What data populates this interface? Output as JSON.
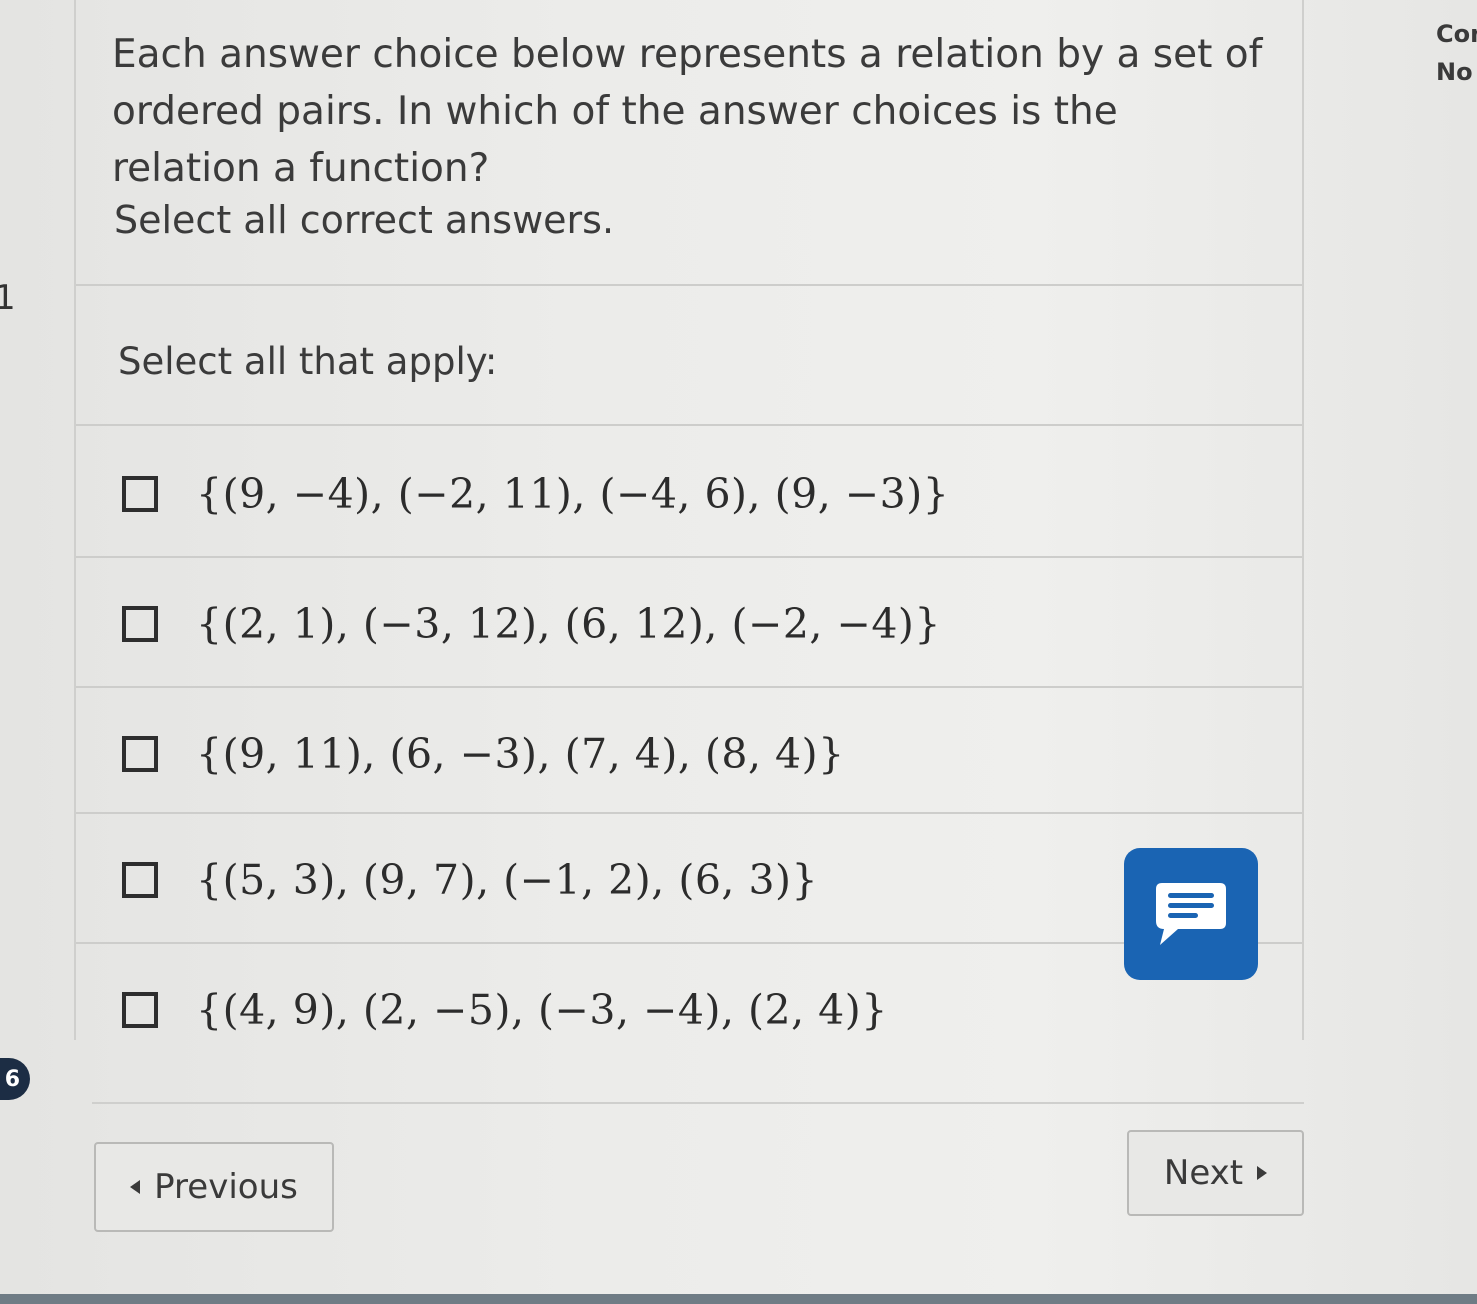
{
  "question": {
    "prompt": "Each answer choice below represents a relation by a set of ordered pairs. In which of the answer choices is the relation a function?",
    "instruction": "Select all correct answers.",
    "select_label": "Select all that apply:"
  },
  "options": [
    {
      "text": "{(9, −4), (−2, 11), (−4, 6), (9, −3)}",
      "checked": false
    },
    {
      "text": "{(2, 1), (−3, 12), (6, 12), (−2, −4)}",
      "checked": false
    },
    {
      "text": "{(9, 11), (6, −3), (7, 4), (8, 4)}",
      "checked": false
    },
    {
      "text": "{(5, 3), (9, 7), (−1, 2), (6, 3)}",
      "checked": false
    },
    {
      "text": "{(4, 9), (2, −5), (−3, −4), (2, 4)}",
      "checked": false
    }
  ],
  "nav": {
    "previous_label": "Previous",
    "next_label": "Next"
  },
  "side_panel": {
    "line1": "Con",
    "line2": "No"
  },
  "left_edge": {
    "mark": "1",
    "badge": "6"
  },
  "colors": {
    "chat_button": "#1a64b3",
    "badge": "#1c2d44"
  },
  "icons": {
    "chat": "chat-bubble-icon",
    "previous": "triangle-left-icon",
    "next": "triangle-right-icon"
  }
}
